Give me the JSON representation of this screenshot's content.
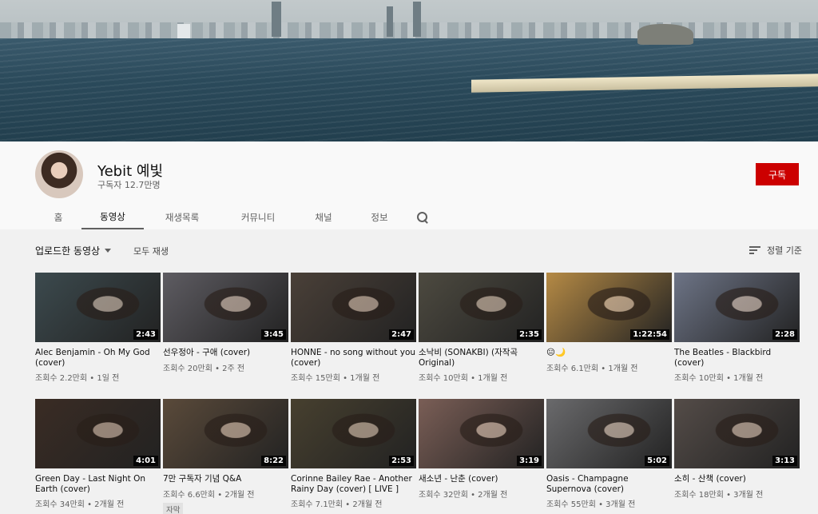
{
  "channel": {
    "name": "Yebit 예빛",
    "subscribers": "구독자 12.7만명",
    "subscribe_label": "구독"
  },
  "tabs": [
    {
      "label": "홈"
    },
    {
      "label": "동영상"
    },
    {
      "label": "재생목록"
    },
    {
      "label": "커뮤니티"
    },
    {
      "label": "채널"
    },
    {
      "label": "정보"
    }
  ],
  "filters": {
    "upload_label": "업로드한 동영상",
    "play_all": "모두 재생",
    "sort_label": "정렬 기준"
  },
  "videos": [
    {
      "title": "Alec Benjamin - Oh My God (cover)",
      "meta": "조회수 2.2만회 • 1일 전",
      "duration": "2:43",
      "tone": "#3c4a4e"
    },
    {
      "title": "선우정아 - 구애 (cover)",
      "meta": "조회수 20만회 • 2주 전",
      "duration": "3:45",
      "tone": "#5e5c62"
    },
    {
      "title": "HONNE - no song without you (cover)",
      "meta": "조회수 15만회 • 1개월 전",
      "duration": "2:47",
      "tone": "#4a4038"
    },
    {
      "title": "소낙비 (SONAKBI) (자작곡 Original)",
      "meta": "조회수 10만회 • 1개월 전",
      "duration": "2:35",
      "tone": "#4d4a40"
    },
    {
      "title": "😐🌙",
      "meta": "조회수 6.1만회 • 1개월 전",
      "duration": "1:22:54",
      "tone": "#b58a45"
    },
    {
      "title": "The Beatles - Blackbird (cover)",
      "meta": "조회수 10만회 • 1개월 전",
      "duration": "2:28",
      "tone": "#6d7486"
    },
    {
      "title": "Green Day - Last Night On Earth (cover)",
      "meta": "조회수 34만회 • 2개월 전",
      "duration": "4:01",
      "tone": "#3a2c24"
    },
    {
      "title": "7만 구독자 기념 Q&A",
      "meta": "조회수 6.6만회 • 2개월 전",
      "duration": "8:22",
      "tone": "#5a4a3a",
      "badge": "자막"
    },
    {
      "title": "Corinne Bailey Rae - Another Rainy Day (cover) [ LIVE ]",
      "meta": "조회수 7.1만회 • 2개월 전",
      "duration": "2:53",
      "tone": "#47402f"
    },
    {
      "title": "새소년 - 난춘 (cover)",
      "meta": "조회수 32만회 • 2개월 전",
      "duration": "3:19",
      "tone": "#7a5e56"
    },
    {
      "title": "Oasis - Champagne Supernova (cover)",
      "meta": "조회수 55만회 • 3개월 전",
      "duration": "5:02",
      "tone": "#6a6a6c"
    },
    {
      "title": "소히 - 산책 (cover)",
      "meta": "조회수 18만회 • 3개월 전",
      "duration": "3:13",
      "tone": "#544c48"
    }
  ]
}
